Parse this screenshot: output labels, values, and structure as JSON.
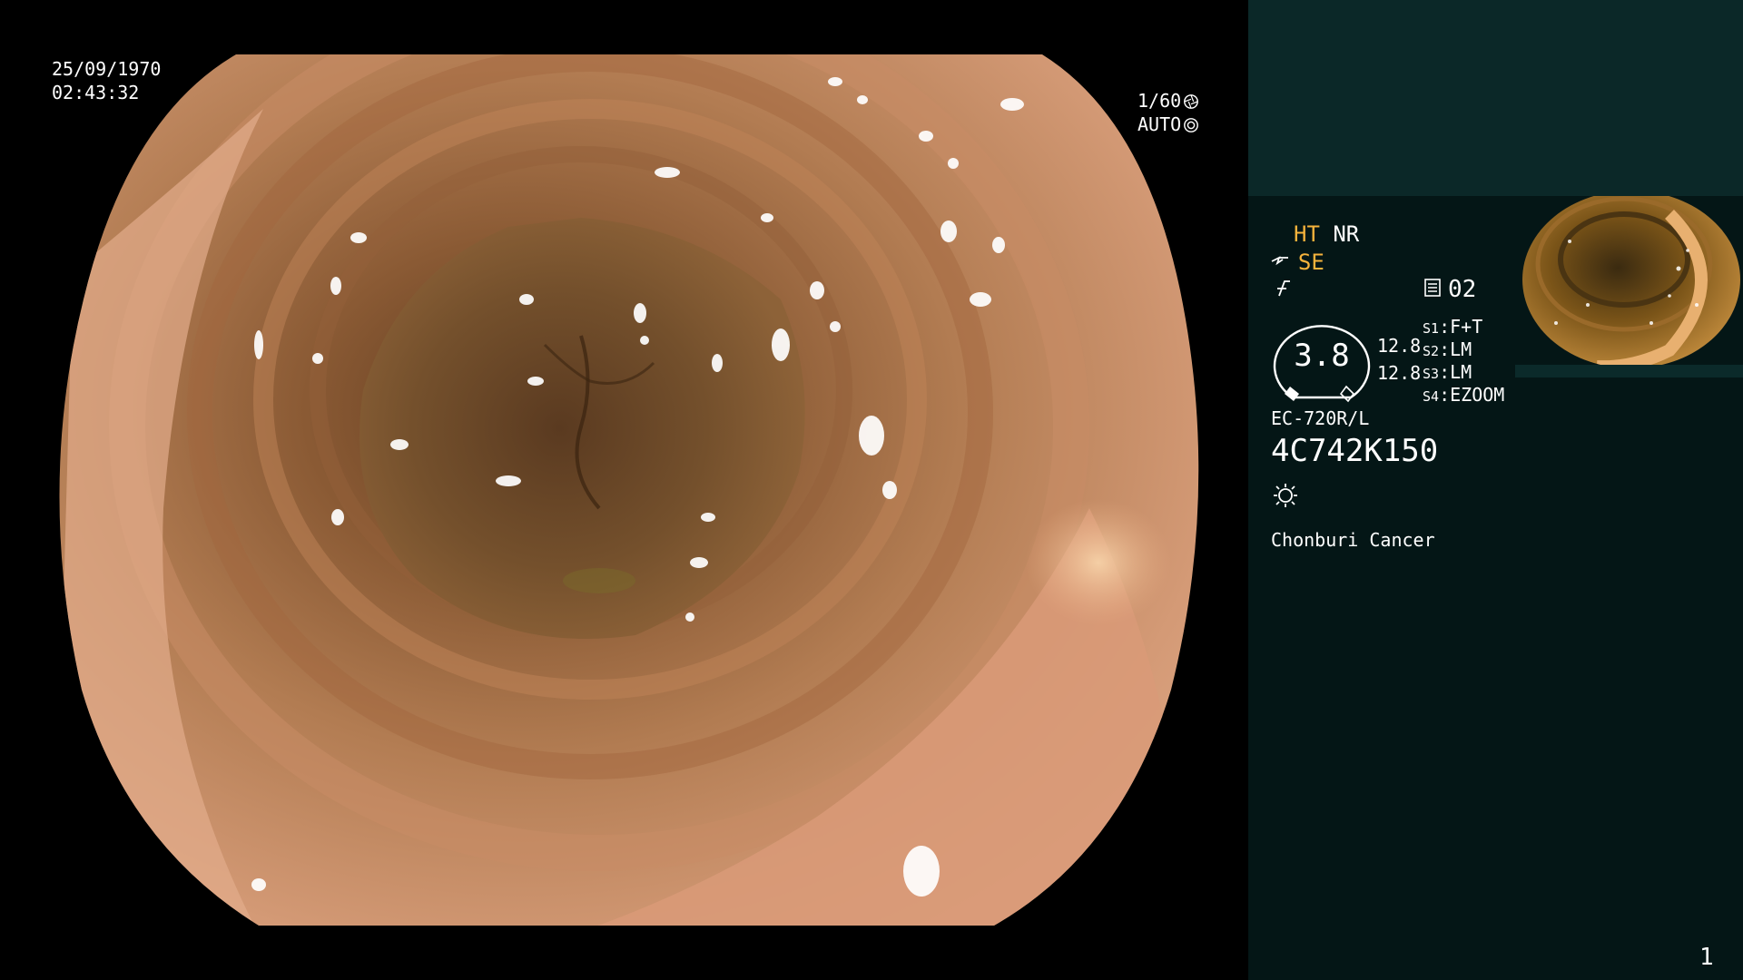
{
  "endoscope_view": {
    "date": "25/09/1970",
    "time": "02:43:32",
    "shutter": "1/60",
    "iris_mode": "AUTO",
    "shutter_icon": "aperture-icon",
    "iris_icon": "iris-ring-icon"
  },
  "info_panel": {
    "mode_ht": "HT",
    "mode_nr": "NR",
    "mode_se": "SE",
    "memory_icon": "memory-card-icon",
    "memory_number": "02",
    "gauge_value": "3.8",
    "gauge_reading_1": "12.8",
    "gauge_reading_2": "12.8",
    "switches": [
      {
        "key": "S1",
        "value": "F+T"
      },
      {
        "key": "S2",
        "value": "LM"
      },
      {
        "key": "S3",
        "value": "LM"
      },
      {
        "key": "S4",
        "value": "EZOOM"
      }
    ],
    "scope_model": "EC-720R/L",
    "serial_number": "4C742K150",
    "light_icon": "light-source-icon",
    "site_name": "Chonburi Cancer",
    "page_number": "1",
    "accent_color": "#f6b33c",
    "panel_color": "#041616",
    "panel_top_color": "#0b2828"
  }
}
